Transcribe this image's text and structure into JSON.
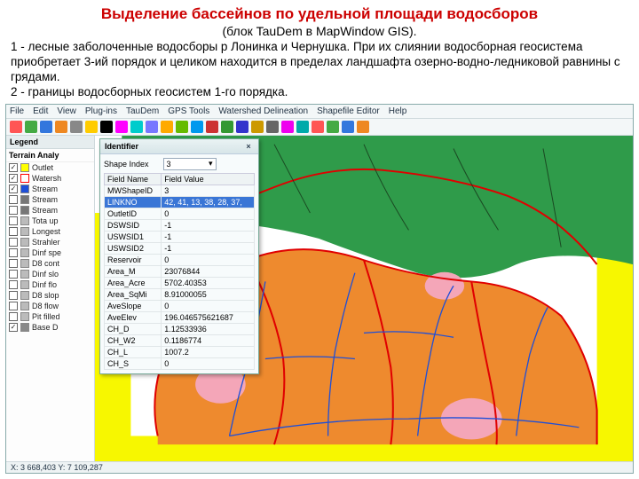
{
  "slide": {
    "title": "Выделение бассейнов по удельной площади водосборов",
    "subtitle": "(блок TauDem в MapWindow GIS).",
    "desc1": "1 - лесные заболоченные водосборы р Лонинка и Чернушка. При их слиянии водосборная геосистема приобретает 3-ий порядок и целиком находится в пределах ландшафта озерно-водно-ледниковой равнины с грядами.",
    "desc2": "2 - границы водосборных геосистем 1-го порядка."
  },
  "menu": [
    "File",
    "Edit",
    "View",
    "Plug-ins",
    "TauDem",
    "GPS Tools",
    "Watershed Delineation",
    "Shapefile Editor",
    "Help"
  ],
  "toolbar_colors": [
    "#f55",
    "#4a4",
    "#37d",
    "#e82",
    "#888",
    "#fc0",
    "#000",
    "#f0f",
    "#0cc",
    "#77f",
    "#fa0",
    "#6b0",
    "#09e",
    "#c33",
    "#393",
    "#33c",
    "#c90",
    "#666",
    "#e0e",
    "#0aa",
    "#f55",
    "#4a4",
    "#37d",
    "#e82"
  ],
  "legend": {
    "tab": "Legend",
    "group": "Terrain Analy",
    "items": [
      {
        "name": "Outlet",
        "chk": true,
        "color": "#ffff00"
      },
      {
        "name": "Watersh",
        "chk": true,
        "color": "#ff0000",
        "outline": true
      },
      {
        "name": "Stream",
        "chk": true,
        "color": "#1e4fd8"
      },
      {
        "name": "Stream",
        "chk": false,
        "color": "#777"
      },
      {
        "name": "Stream",
        "chk": false,
        "color": "#777"
      },
      {
        "name": "Tota up",
        "chk": false,
        "color": "#bbb"
      },
      {
        "name": "Longest",
        "chk": false,
        "color": "#bbb"
      },
      {
        "name": "Strahler",
        "chk": false,
        "color": "#bbb"
      },
      {
        "name": "Dinf spe",
        "chk": false,
        "color": "#bbb"
      },
      {
        "name": "D8 cont",
        "chk": false,
        "color": "#bbb"
      },
      {
        "name": "Dinf slo",
        "chk": false,
        "color": "#bbb"
      },
      {
        "name": "Dinf flo",
        "chk": false,
        "color": "#bbb"
      },
      {
        "name": "D8 slop",
        "chk": false,
        "color": "#bbb"
      },
      {
        "name": "D8 flow",
        "chk": false,
        "color": "#bbb"
      },
      {
        "name": "Pit filled",
        "chk": false,
        "color": "#bbb"
      },
      {
        "name": "Base D",
        "chk": true,
        "color": "#888"
      }
    ]
  },
  "identifier": {
    "title": "Identifier",
    "shape_index_label": "Shape Index",
    "shape_index_value": "3",
    "headers": [
      "Field Name",
      "Field Value"
    ],
    "rows": [
      {
        "k": "MWShapeID",
        "v": "3"
      },
      {
        "k": "LINKNO",
        "v": "42, 41, 13, 38, 28, 37,",
        "sel": true
      },
      {
        "k": "OutletID",
        "v": "0"
      },
      {
        "k": "DSWSID",
        "v": "-1"
      },
      {
        "k": "USWSID1",
        "v": "-1"
      },
      {
        "k": "USWSID2",
        "v": "-1"
      },
      {
        "k": "Reservoir",
        "v": "0"
      },
      {
        "k": "Area_M",
        "v": "23076844"
      },
      {
        "k": "Area_Acre",
        "v": "5702.40353"
      },
      {
        "k": "Area_SqMi",
        "v": "8.91000055"
      },
      {
        "k": "AveSlope",
        "v": "0"
      },
      {
        "k": "AveElev",
        "v": "196.046575621687"
      },
      {
        "k": "CH_D",
        "v": "1.12533936"
      },
      {
        "k": "CH_W2",
        "v": "0.1186774"
      },
      {
        "k": "CH_L",
        "v": "1007.2"
      },
      {
        "k": "CH_S",
        "v": "0"
      }
    ]
  },
  "statusbar": "X: 3 668,403 Y: 7 109,287"
}
